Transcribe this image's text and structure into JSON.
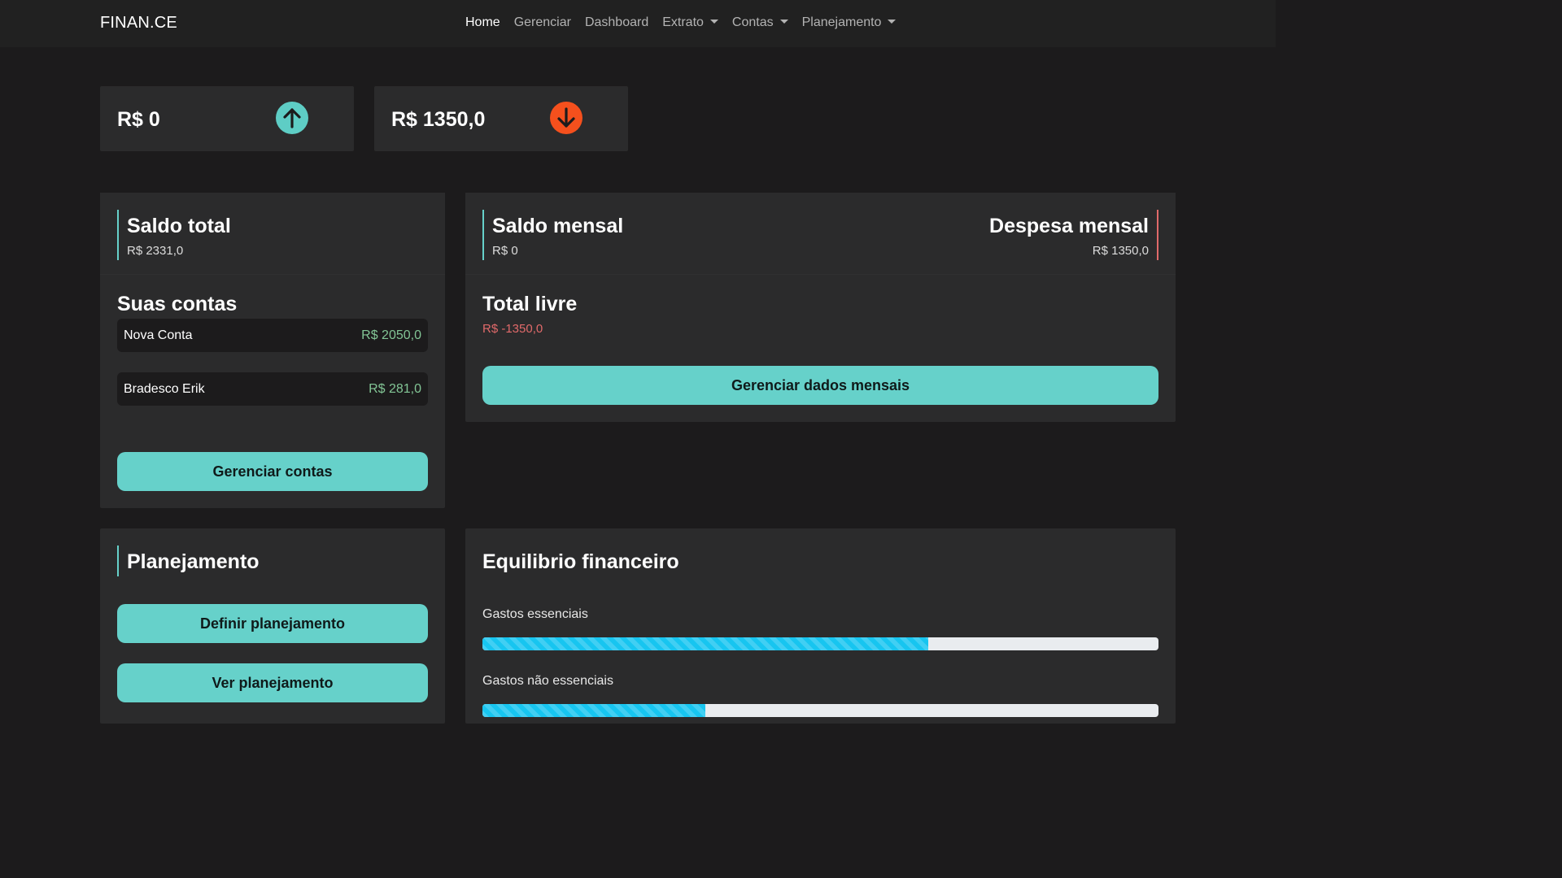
{
  "app": {
    "brand": "FINAN.CE"
  },
  "nav": {
    "items": [
      {
        "label": "Home",
        "active": true,
        "dropdown": false
      },
      {
        "label": "Gerenciar",
        "active": false,
        "dropdown": false
      },
      {
        "label": "Dashboard",
        "active": false,
        "dropdown": false
      },
      {
        "label": "Extrato",
        "active": false,
        "dropdown": true
      },
      {
        "label": "Contas",
        "active": false,
        "dropdown": true
      },
      {
        "label": "Planejamento",
        "active": false,
        "dropdown": true
      }
    ]
  },
  "summary": {
    "income": {
      "amount": "R$ 0",
      "icon": "arrow-up-circle-icon",
      "color": "#5ecdc5"
    },
    "expense": {
      "amount": "R$ 1350,0",
      "icon": "arrow-down-circle-icon",
      "color": "#f5501d"
    }
  },
  "balance_card": {
    "title": "Saldo total",
    "value": "R$ 2331,0",
    "accounts_title": "Suas contas",
    "accounts": [
      {
        "name": "Nova Conta",
        "value": "R$ 2050,0"
      },
      {
        "name": "Bradesco Erik",
        "value": "R$ 281,0"
      }
    ],
    "manage_button": "Gerenciar contas"
  },
  "monthly_card": {
    "balance_title": "Saldo mensal",
    "balance_value": "R$ 0",
    "expense_title": "Despesa mensal",
    "expense_value": "R$ 1350,0",
    "free_title": "Total livre",
    "free_value": "R$ -1350,0",
    "manage_button": "Gerenciar dados mensais"
  },
  "planning_card": {
    "title": "Planejamento",
    "define_button": "Definir planejamento",
    "view_button": "Ver planejamento"
  },
  "balance_equilibrium": {
    "title": "Equilibrio financeiro",
    "bars": [
      {
        "label": "Gastos essenciais",
        "fraction": 0.66
      },
      {
        "label": "Gastos não essenciais",
        "fraction": 0.33
      }
    ]
  },
  "colors": {
    "accent": "#66d1ca",
    "danger": "#e16a6a",
    "positive": "#82c595",
    "progress": "#17c5f0"
  }
}
